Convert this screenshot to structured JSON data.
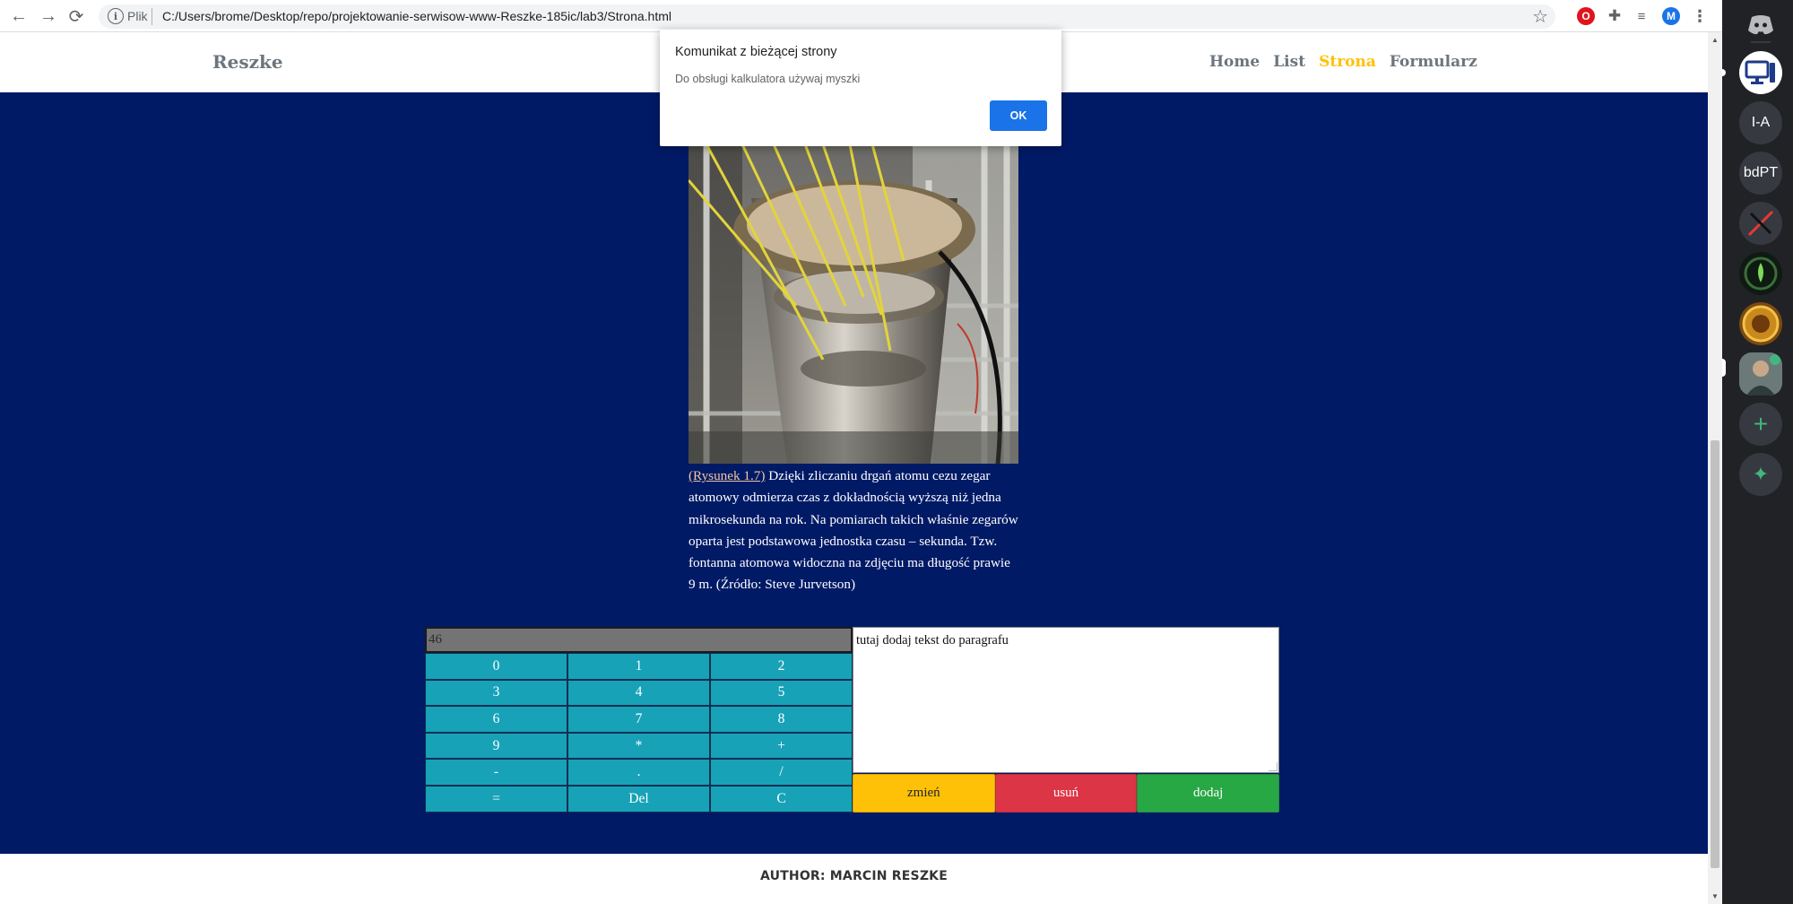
{
  "browser": {
    "back_icon": "←",
    "forward_icon": "→",
    "reload_icon": "⟳",
    "info_icon": "i",
    "url_scheme_label": "Plik",
    "url": "C:/Users/brome/Desktop/repo/projektowanie-serwisow-www-Reszke-185ic/lab3/Strona.html",
    "bookmark_icon": "☆",
    "extensions": {
      "opera_icon": "O",
      "puzzle_icon": "✚",
      "queue_icon": "≡",
      "profile_initial": "M",
      "menu_icon": "⋮"
    }
  },
  "site": {
    "logo": "Reszke",
    "nav": [
      {
        "label": "Home",
        "active": false
      },
      {
        "label": "List",
        "active": false
      },
      {
        "label": "Strona",
        "active": true
      },
      {
        "label": "Formularz",
        "active": false
      }
    ],
    "nav_active_color": "#ffc107",
    "main_background": "#001a66"
  },
  "figure": {
    "caption_link": "(Rysunek 1.7)",
    "caption_text": " Dzięki zliczaniu drgań atomu cezu zegar atomowy odmierza czas z dokładnością wyższą niż jedna mikrosekunda na rok. Na pomiarach takich właśnie zegarów oparta jest podstawowa jednostka czasu – sekunda. Tzw. fontanna atomowa widoczna na zdjęciu ma długość prawie 9 m. (Źródło: Steve Jurvetson)"
  },
  "calculator": {
    "display": "46",
    "keys": [
      "0",
      "1",
      "2",
      "3",
      "4",
      "5",
      "6",
      "7",
      "8",
      "9",
      "*",
      "+",
      "-",
      ".",
      "/",
      "=",
      "Del",
      "C"
    ]
  },
  "paragraph_editor": {
    "textarea_value": "tutaj dodaj tekst do paragrafu",
    "buttons": {
      "change": "zmień",
      "remove": "usuń",
      "add": "dodaj"
    }
  },
  "footer": {
    "text": "AUTHOR: MARCIN RESZKE"
  },
  "alert": {
    "title": "Komunikat z bieżącej strony",
    "message": "Do obsługi kalkulatora używaj myszki",
    "ok": "OK"
  },
  "sidebar": {
    "servers": [
      "I-A",
      "bdPT"
    ],
    "discord_icon": "discord-icon",
    "add_icon": "+",
    "explore_icon": "✦"
  }
}
